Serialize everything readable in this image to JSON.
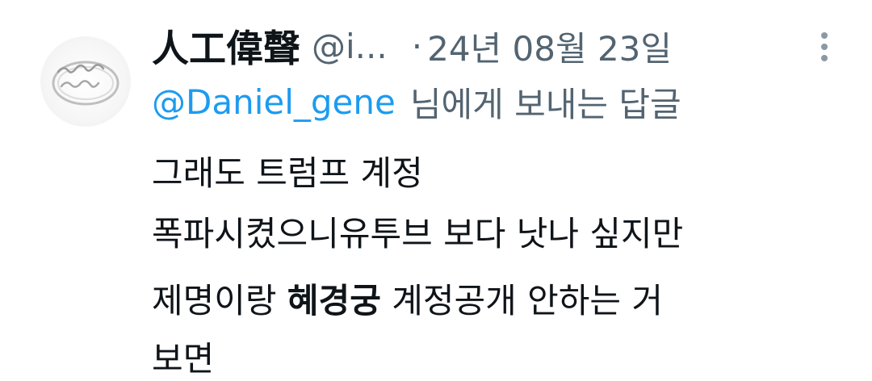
{
  "tweet": {
    "author": {
      "display_name": "人工偉聲",
      "handle": "@i...",
      "avatar_icon": "avatar-ring-image"
    },
    "separator": "·",
    "date": "24년 08월 23일",
    "more_icon": "more-vertical-icon",
    "reply": {
      "mention": "@Daniel_gene",
      "suffix": "님에게 보내는 답글"
    },
    "text": {
      "line1": "그래도 트럼프 계정",
      "line2": "폭파시켰으니유투브 보다 낫나 싶지만",
      "line3_pre": "제명이랑 ",
      "line3_bold": "혜경궁",
      "line3_post": " 계정공개 안하는 거",
      "line4": "보면"
    }
  },
  "colors": {
    "text_primary": "#0f1419",
    "text_secondary": "#536471",
    "accent": "#1d9bf0"
  }
}
